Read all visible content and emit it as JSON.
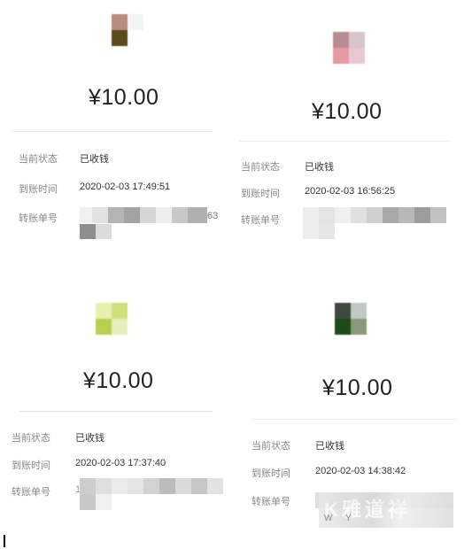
{
  "cards": [
    {
      "amount": "¥10.00",
      "status_label": "当前状态",
      "status_value": "已收钱",
      "time_label": "到账时间",
      "time_value": "2020-02-03 17:49:51",
      "txn_label": "转账单号",
      "txn_visible_fragment": "63",
      "avatar_colors": [
        "#b98a80",
        "#f4f4f4",
        "#5a4a1c",
        "#ffffff"
      ]
    },
    {
      "amount": "¥10.00",
      "status_label": "当前状态",
      "status_value": "已收钱",
      "time_label": "到账时间",
      "time_value": "2020-02-03 16:56:25",
      "txn_label": "转账单号",
      "avatar_colors": [
        "#b78d93",
        "#d8c5cb",
        "#e59aa2",
        "#e8c9cf"
      ]
    },
    {
      "amount": "¥10.00",
      "status_label": "当前状态",
      "status_value": "已收钱",
      "time_label": "到账时间",
      "time_value": "2020-02-03 17:37:40",
      "txn_label": "转账单号",
      "txn_visible_fragment": "1",
      "avatar_colors": [
        "#e8f0b0",
        "#cfe07a",
        "#b8d04e",
        "#e6efba"
      ]
    },
    {
      "amount": "¥10.00",
      "status_label": "当前状态",
      "status_value": "已收钱",
      "time_label": "到账时间",
      "time_value": "2020-02-03 14:38:42",
      "txn_label": "转账单号",
      "avatar_colors": [
        "#3e4a40",
        "#bfc9c2",
        "#1c4a18",
        "#8a9a78"
      ]
    }
  ],
  "watermark": {
    "text": "K雅道祥",
    "sub": "W Y"
  },
  "colors": {
    "background": "#ffffff",
    "divider": "#ececec",
    "label": "#888888",
    "value": "#333333"
  }
}
